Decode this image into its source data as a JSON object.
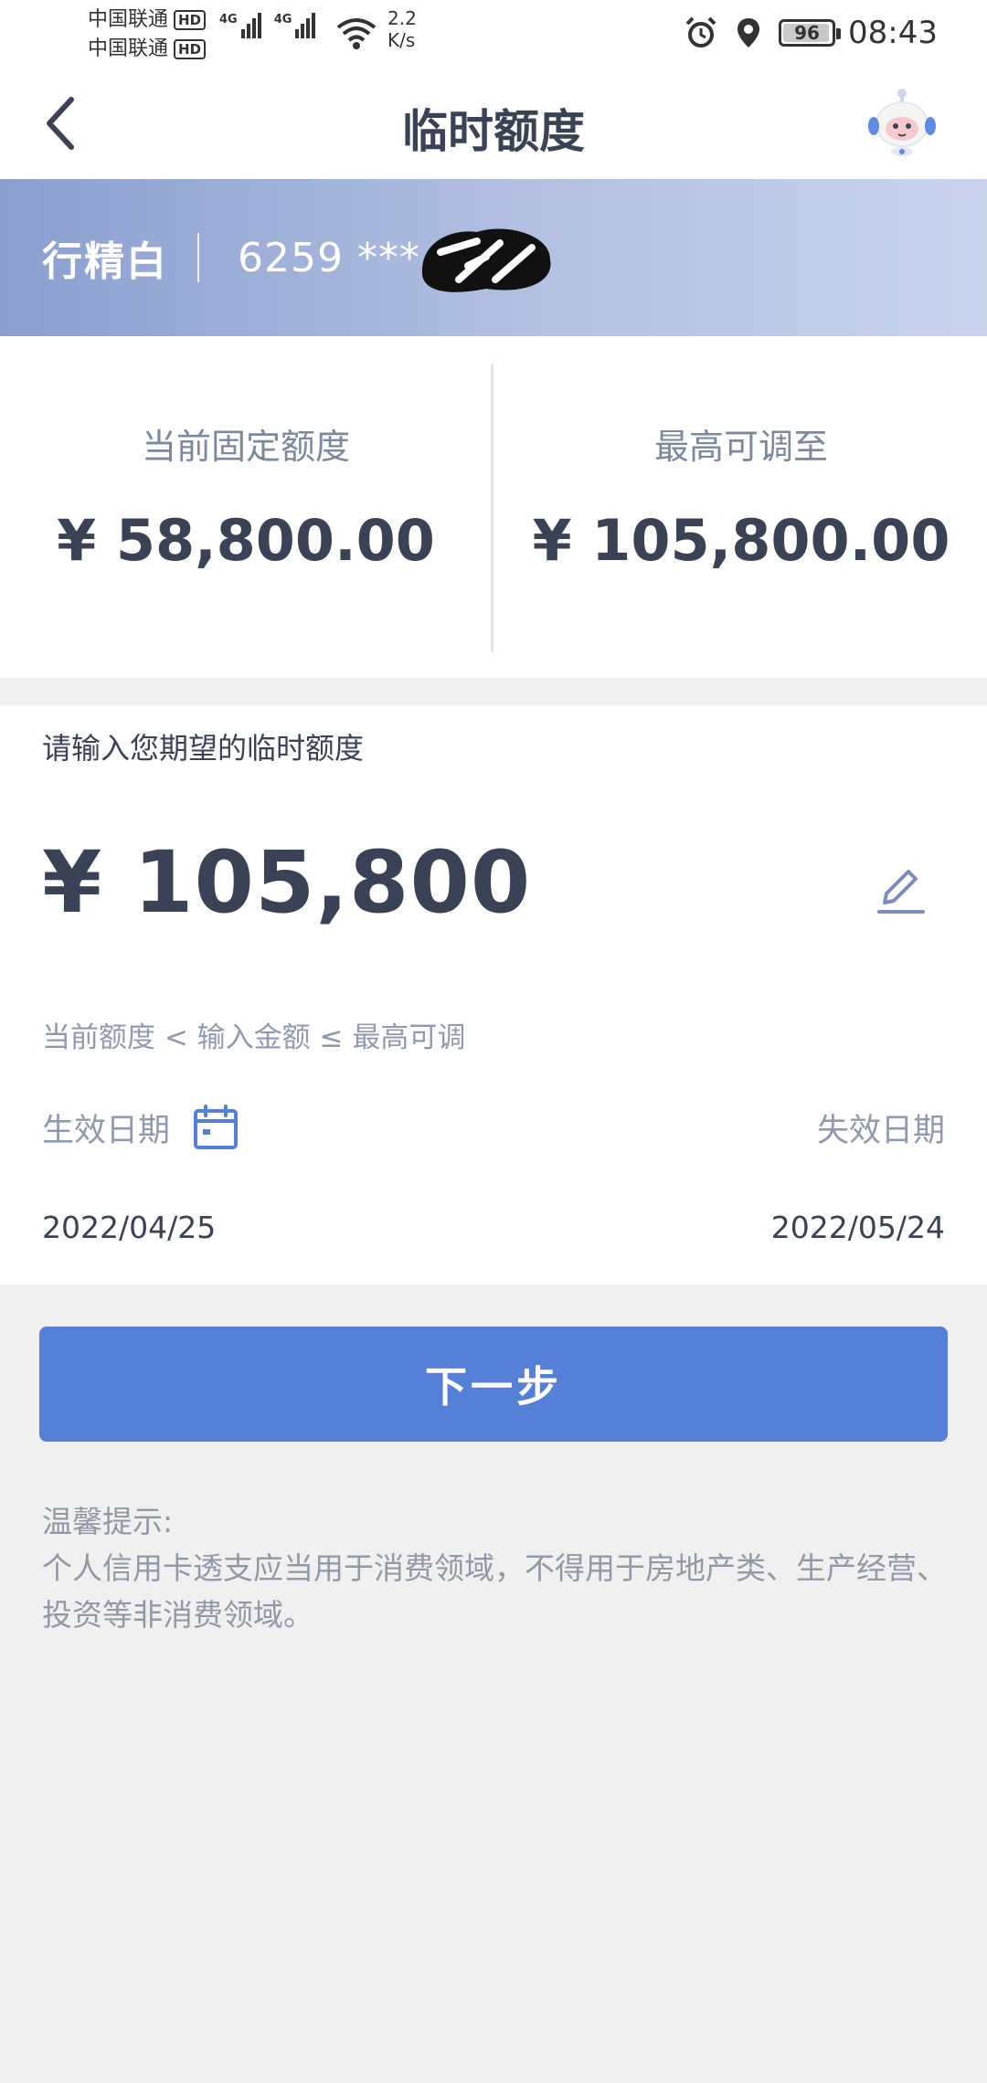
{
  "status_bar": {
    "carrier_1": "中国联通",
    "carrier_2": "中国联通",
    "hd_badge": "HD",
    "network_type_1": "4G",
    "network_type_2": "4G",
    "speed_value": "2.2",
    "speed_unit": "K/s",
    "battery_level": "96",
    "time": "08:43",
    "icons": [
      "signal-icon",
      "wifi-icon",
      "alarm-icon",
      "location-icon",
      "battery-icon"
    ]
  },
  "header": {
    "title": "临时额度",
    "back_icon": "chevron-left-icon",
    "assistant_icon": "robot-assistant-icon"
  },
  "card": {
    "name": "行精白",
    "number_masked": "6259 ***"
  },
  "limits": {
    "current_label": "当前固定额度",
    "current_value": "¥ 58,800.00",
    "max_label": "最高可调至",
    "max_value": "¥ 105,800.00"
  },
  "input": {
    "prompt": "请输入您期望的临时额度",
    "amount": "¥ 105,800",
    "edit_icon": "pencil-icon",
    "rule": "当前额度 < 输入金额 ≤ 最高可调",
    "effective_label": "生效日期",
    "calendar_icon": "calendar-icon",
    "expiry_label": "失效日期",
    "effective_date": "2022/04/25",
    "expiry_date": "2022/05/24"
  },
  "actions": {
    "next_label": "下一步"
  },
  "tips": {
    "title": "温馨提示:",
    "body": "个人信用卡透支应当用于消费领域，不得用于房地产类、生产经营、投资等非消费领域。"
  },
  "colors": {
    "primary_button": "#5480d8",
    "text_dark": "#3a4256",
    "text_muted": "#8f9ab0",
    "banner_gradient_start": "#8a9fd0",
    "banner_gradient_end": "#c9d3ec",
    "page_background": "#f0f0f0"
  }
}
